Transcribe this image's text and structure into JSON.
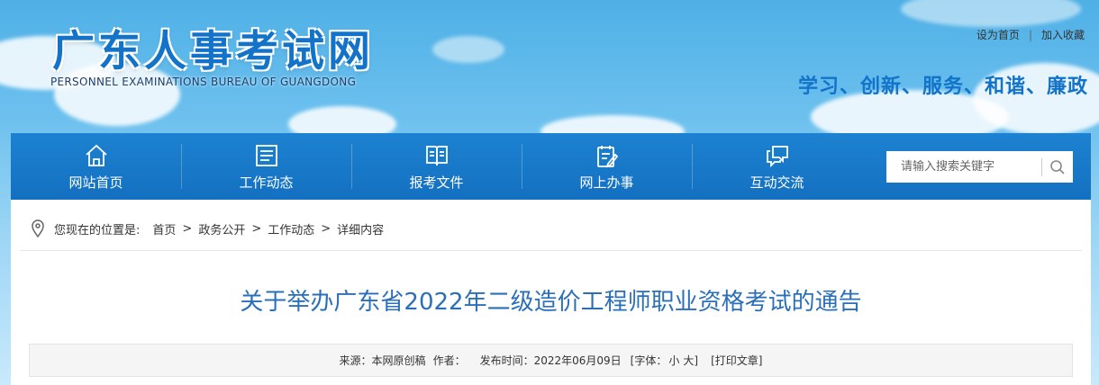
{
  "header": {
    "logo_title": "广东人事考试网",
    "logo_subtitle": "PERSONNEL EXAMINATIONS BUREAU OF GUANGDONG",
    "top_links": {
      "set_home": "设为首页",
      "separator": "|",
      "bookmark": "加入收藏"
    },
    "slogan": "学习、创新、服务、和谐、廉政"
  },
  "nav": {
    "items": [
      {
        "label": "网站首页",
        "icon": "home-icon"
      },
      {
        "label": "工作动态",
        "icon": "news-icon"
      },
      {
        "label": "报考文件",
        "icon": "document-icon"
      },
      {
        "label": "网上办事",
        "icon": "edit-icon"
      },
      {
        "label": "互动交流",
        "icon": "chat-icon"
      }
    ],
    "search_placeholder": "请输入搜索关键字"
  },
  "breadcrumb": {
    "prefix": "您现在的位置是:",
    "items": [
      "首页",
      "政务公开",
      "工作动态",
      "详细内容"
    ],
    "separator": ">"
  },
  "article": {
    "title": "关于举办广东省2022年二级造价工程师职业资格考试的通告",
    "meta": {
      "source": "来源：本网原创稿",
      "author": "作者：",
      "date": "发布时间：2022年06月09日",
      "font_open": "[字体：",
      "font_small": "小",
      "font_large": "大",
      "font_close": "]",
      "print": "[打印文章]"
    }
  },
  "colors": {
    "brand_blue": "#1273c9",
    "nav_blue": "#1a7acb",
    "title_blue": "#2a6fb8"
  }
}
